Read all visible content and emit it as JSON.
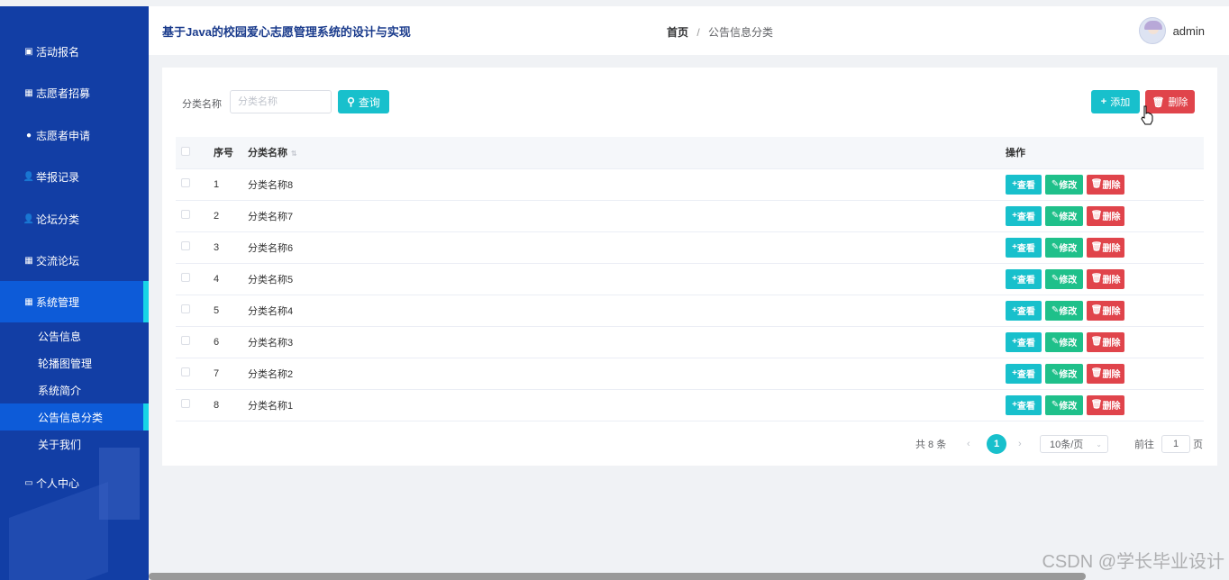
{
  "sidebar": {
    "items": [
      {
        "label": "活动报名",
        "icon": "calendar-icon"
      },
      {
        "label": "志愿者招募",
        "icon": "grid-icon"
      },
      {
        "label": "志愿者申请",
        "icon": "bulb-icon"
      },
      {
        "label": "举报记录",
        "icon": "user-icon"
      },
      {
        "label": "论坛分类",
        "icon": "user-icon"
      },
      {
        "label": "交流论坛",
        "icon": "grid-icon"
      },
      {
        "label": "系统管理",
        "icon": "grid-icon"
      },
      {
        "label": "个人中心",
        "icon": "card-icon"
      }
    ],
    "subitems": [
      "公告信息",
      "轮播图管理",
      "系统简介",
      "公告信息分类",
      "关于我们"
    ]
  },
  "header": {
    "title": "基于Java的校园爱心志愿管理系统的设计与实现",
    "breadcrumb_home": "首页",
    "breadcrumb_current": "公告信息分类",
    "username": "admin"
  },
  "search": {
    "label": "分类名称",
    "placeholder": "分类名称",
    "query_label": "查询"
  },
  "toolbar": {
    "add_label": "添加",
    "delete_label": "删除"
  },
  "table": {
    "headers": {
      "no": "序号",
      "name": "分类名称",
      "op": "操作"
    },
    "rows": [
      {
        "no": "1",
        "name": "分类名称8"
      },
      {
        "no": "2",
        "name": "分类名称7"
      },
      {
        "no": "3",
        "name": "分类名称6"
      },
      {
        "no": "4",
        "name": "分类名称5"
      },
      {
        "no": "5",
        "name": "分类名称4"
      },
      {
        "no": "6",
        "name": "分类名称3"
      },
      {
        "no": "7",
        "name": "分类名称2"
      },
      {
        "no": "8",
        "name": "分类名称1"
      }
    ],
    "ops": {
      "view": "查看",
      "edit": "修改",
      "delete": "删除"
    }
  },
  "pagination": {
    "total": "共 8 条",
    "current": "1",
    "page_size": "10条/页",
    "goto_prefix": "前往",
    "goto_value": "1",
    "goto_suffix": "页"
  },
  "watermark": "CSDN @学长毕业设计",
  "colors": {
    "sidebar": "#123ea5",
    "accent": "#18c0cc",
    "success": "#1fc08a",
    "danger": "#e0444b"
  }
}
